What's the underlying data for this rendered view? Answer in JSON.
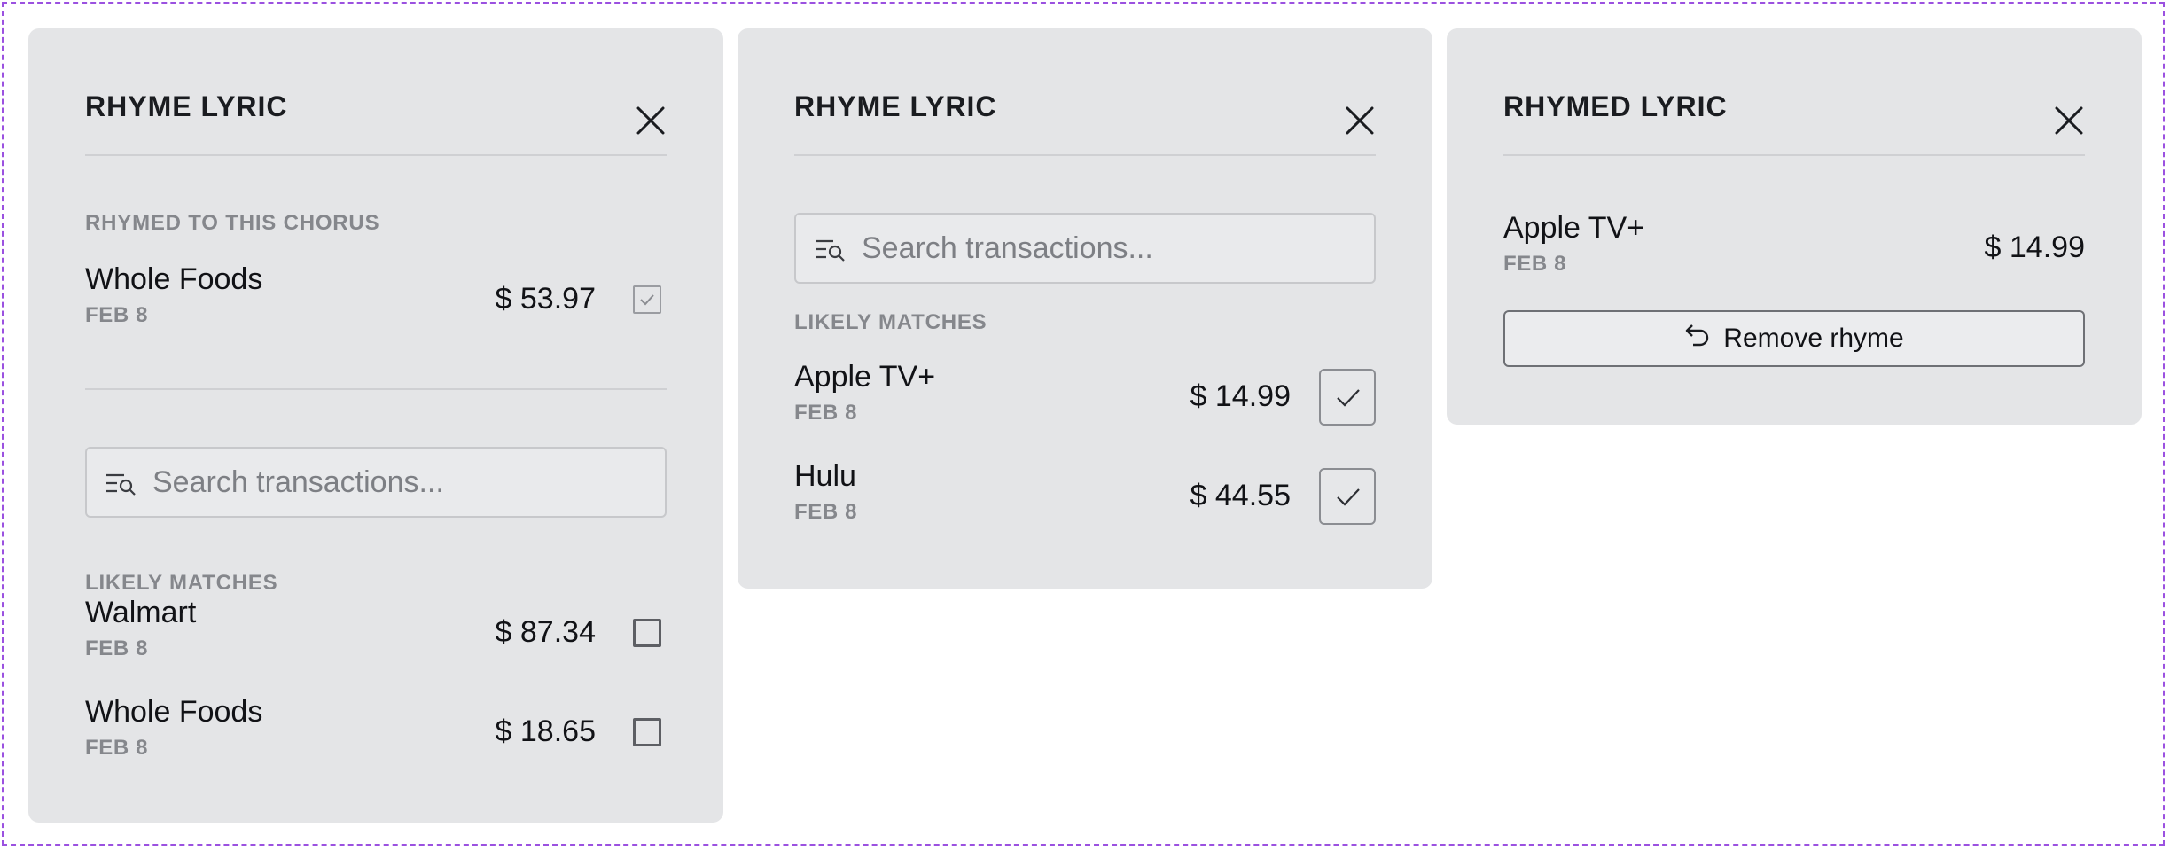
{
  "colors": {
    "frame_border": "#9b51e0",
    "panel_bg": "#e4e5e7",
    "label_gray": "#85878c"
  },
  "icons": {
    "close": "close-icon",
    "check": "check-icon",
    "search": "search-filter-icon",
    "undo": "undo-icon"
  },
  "panel1": {
    "title": "RHYME LYRIC",
    "rhymed_label": "RHYMED TO THIS CHORUS",
    "rhymed_item": {
      "name": "Whole Foods",
      "date": "FEB 8",
      "amount": "$ 53.97",
      "checked": true
    },
    "search_placeholder": "Search transactions...",
    "matches_label": "LIKELY MATCHES",
    "matches": [
      {
        "name": "Walmart",
        "date": "FEB 8",
        "amount": "$ 87.34",
        "checked": false
      },
      {
        "name": "Whole Foods",
        "date": "FEB 8",
        "amount": "$ 18.65",
        "checked": false
      }
    ]
  },
  "panel2": {
    "title": "RHYME LYRIC",
    "search_placeholder": "Search transactions...",
    "matches_label": "LIKELY MATCHES",
    "matches": [
      {
        "name": "Apple TV+",
        "date": "FEB 8",
        "amount": "$ 14.99",
        "checked": true
      },
      {
        "name": "Hulu",
        "date": "FEB 8",
        "amount": "$ 44.55",
        "checked": true
      }
    ]
  },
  "panel3": {
    "title": "RHYMED LYRIC",
    "item": {
      "name": "Apple TV+",
      "date": "FEB 8",
      "amount": "$ 14.99"
    },
    "remove_label": "Remove rhyme"
  }
}
